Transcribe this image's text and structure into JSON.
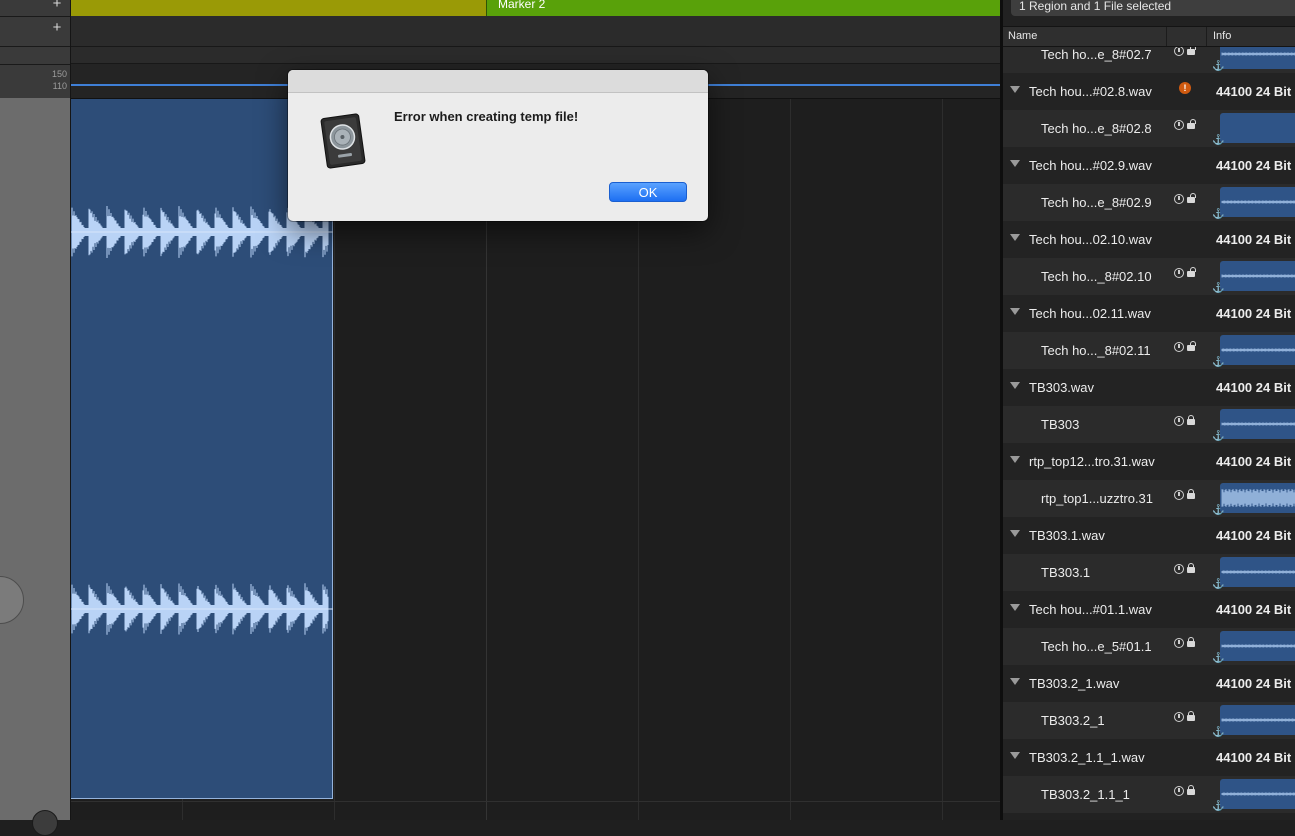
{
  "global_tracks": {
    "add_icon": "plus-icon",
    "markers": [
      {
        "label": "",
        "color": "#9a9a06"
      },
      {
        "label": "Marker 2",
        "color": "#59a10a"
      }
    ],
    "tempo_values": [
      "150",
      "110"
    ]
  },
  "region_color": "#2d4d78",
  "browser": {
    "status": "1 Region and 1 File selected",
    "columns": {
      "name": "Name",
      "info": "Info"
    },
    "rows": [
      {
        "kind": "child",
        "name": "Tech ho...e_8#02.7",
        "info": "",
        "status": "clock-lock"
      },
      {
        "kind": "parent",
        "name": "Tech hou...#02.8.wav",
        "info": "44100  24 Bit",
        "status": "warning"
      },
      {
        "kind": "child",
        "name": "Tech ho...e_8#02.8",
        "info": "",
        "status": "clock-lock"
      },
      {
        "kind": "parent",
        "name": "Tech hou...#02.9.wav",
        "info": "44100  24 Bit",
        "status": ""
      },
      {
        "kind": "child",
        "name": "Tech ho...e_8#02.9",
        "info": "",
        "status": "clock-lock"
      },
      {
        "kind": "parent",
        "name": "Tech hou...02.10.wav",
        "info": "44100  24 Bit",
        "status": ""
      },
      {
        "kind": "child",
        "name": "Tech ho..._8#02.10",
        "info": "",
        "status": "clock-lock"
      },
      {
        "kind": "parent",
        "name": "Tech hou...02.11.wav",
        "info": "44100  24 Bit",
        "status": ""
      },
      {
        "kind": "child",
        "name": "Tech ho..._8#02.11",
        "info": "",
        "status": "clock-lock"
      },
      {
        "kind": "parent",
        "name": "TB303.wav",
        "info": "44100  24 Bit",
        "status": ""
      },
      {
        "kind": "child",
        "name": "TB303",
        "info": "",
        "status": "clock-lock"
      },
      {
        "kind": "parent",
        "name": "rtp_top12...tro.31.wav",
        "info": "44100  24 Bit",
        "status": ""
      },
      {
        "kind": "child",
        "name": "rtp_top1...uzztro.31",
        "info": "",
        "status": "clock-lock"
      },
      {
        "kind": "parent",
        "name": "TB303.1.wav",
        "info": "44100  24 Bit",
        "status": ""
      },
      {
        "kind": "child",
        "name": "TB303.1",
        "info": "",
        "status": "clock-lock"
      },
      {
        "kind": "parent",
        "name": "Tech hou...#01.1.wav",
        "info": "44100  24 Bit",
        "status": ""
      },
      {
        "kind": "child",
        "name": "Tech ho...e_5#01.1",
        "info": "",
        "status": "clock-lock"
      },
      {
        "kind": "parent",
        "name": "TB303.2_1.wav",
        "info": "44100  24 Bit",
        "status": ""
      },
      {
        "kind": "child",
        "name": "TB303.2_1",
        "info": "",
        "status": "clock-lock"
      },
      {
        "kind": "parent",
        "name": "TB303.2_1.1_1.wav",
        "info": "44100  24 Bit",
        "status": ""
      },
      {
        "kind": "child",
        "name": "TB303.2_1.1_1",
        "info": "",
        "status": "clock-lock"
      }
    ]
  },
  "alert": {
    "icon": "logic-pro-app-icon",
    "message": "Error when creating temp file!",
    "ok_label": "OK",
    "ok_color": "#1d6ff2"
  }
}
